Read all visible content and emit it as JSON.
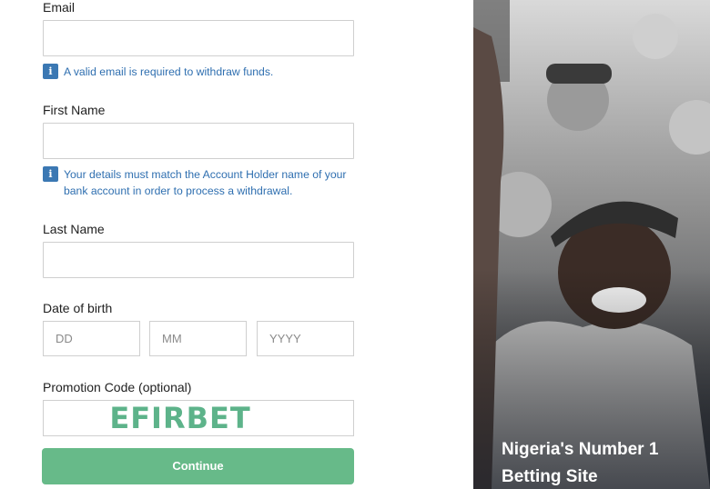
{
  "form": {
    "email_label": "Email",
    "email_value": "",
    "email_hint": "A valid email is required to withdraw funds.",
    "first_name_label": "First Name",
    "first_name_value": "",
    "name_hint": "Your details must match the Account Holder name of your bank account in order to process a withdrawal.",
    "last_name_label": "Last Name",
    "last_name_value": "",
    "dob_label": "Date of birth",
    "dob_day_placeholder": "DD",
    "dob_month_placeholder": "MM",
    "dob_year_placeholder": "YYYY",
    "promo_label": "Promotion Code (optional)",
    "promo_value": "EFIRBET",
    "continue_label": "Continue"
  },
  "hero": {
    "caption_line1": "Nigeria's Number 1",
    "caption_line2": "Betting Site"
  },
  "colors": {
    "accent_green": "#67ba89",
    "promo_green": "#5db38a",
    "hint_blue": "#2f6fb0",
    "info_icon_bg": "#3b78b3"
  },
  "icons": {
    "info": "info-icon"
  }
}
